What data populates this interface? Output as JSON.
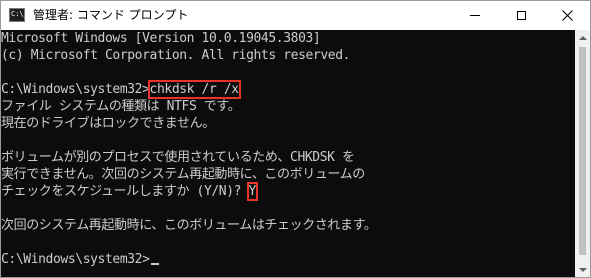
{
  "window": {
    "title": "管理者: コマンド プロンプト",
    "icon": "cmd-icon",
    "icon_text": "C:\\_",
    "buttons": {
      "minimize": "minimize-icon",
      "maximize": "maximize-icon",
      "close": "close-icon"
    }
  },
  "console": {
    "lines": [
      "Microsoft Windows [Version 10.0.19045.3803]",
      "(c) Microsoft Corporation. All rights reserved.",
      "",
      "",
      "ファイル システムの種類は NTFS です。",
      "現在のドライブはロックできません。",
      "",
      "ボリュームが別のプロセスで使用されているため、CHKDSK を",
      "実行できません。次回のシステム再起動時に、このボリュームの",
      "",
      "",
      "次回のシステム再起動時に、このボリュームはチェックされます。",
      "",
      ""
    ],
    "prompt1": "C:\\Windows\\system32>",
    "command": "chkdsk /r /x",
    "question": "チェックをスケジュールしますか (Y/N)? ",
    "answer": "Y",
    "prompt2": "C:\\Windows\\system32>"
  },
  "colors": {
    "background": "#0c0c0c",
    "text": "#cccccc",
    "highlight": "#e8352a"
  }
}
